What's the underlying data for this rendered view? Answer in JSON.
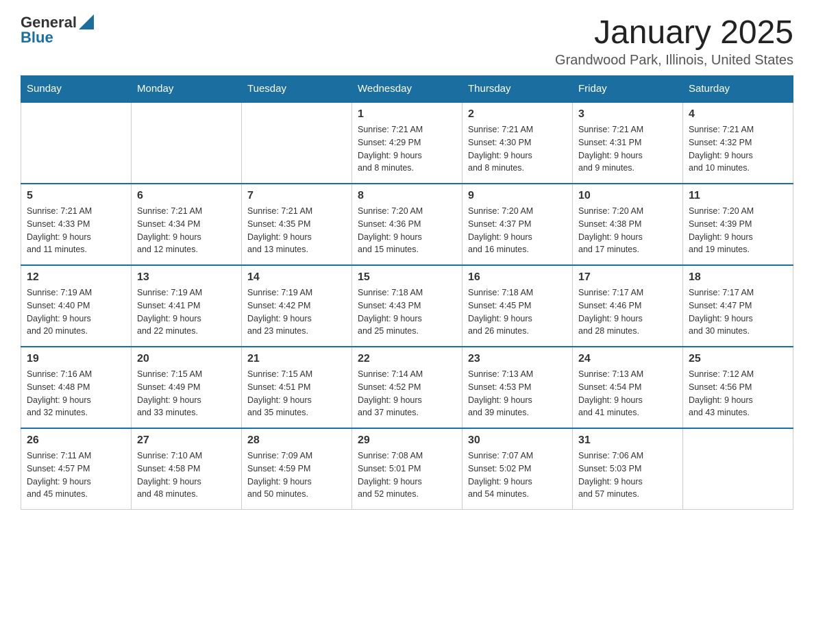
{
  "header": {
    "logo_general": "General",
    "logo_blue": "Blue",
    "month_title": "January 2025",
    "location": "Grandwood Park, Illinois, United States"
  },
  "days_of_week": [
    "Sunday",
    "Monday",
    "Tuesday",
    "Wednesday",
    "Thursday",
    "Friday",
    "Saturday"
  ],
  "weeks": [
    [
      {
        "day": "",
        "info": ""
      },
      {
        "day": "",
        "info": ""
      },
      {
        "day": "",
        "info": ""
      },
      {
        "day": "1",
        "info": "Sunrise: 7:21 AM\nSunset: 4:29 PM\nDaylight: 9 hours\nand 8 minutes."
      },
      {
        "day": "2",
        "info": "Sunrise: 7:21 AM\nSunset: 4:30 PM\nDaylight: 9 hours\nand 8 minutes."
      },
      {
        "day": "3",
        "info": "Sunrise: 7:21 AM\nSunset: 4:31 PM\nDaylight: 9 hours\nand 9 minutes."
      },
      {
        "day": "4",
        "info": "Sunrise: 7:21 AM\nSunset: 4:32 PM\nDaylight: 9 hours\nand 10 minutes."
      }
    ],
    [
      {
        "day": "5",
        "info": "Sunrise: 7:21 AM\nSunset: 4:33 PM\nDaylight: 9 hours\nand 11 minutes."
      },
      {
        "day": "6",
        "info": "Sunrise: 7:21 AM\nSunset: 4:34 PM\nDaylight: 9 hours\nand 12 minutes."
      },
      {
        "day": "7",
        "info": "Sunrise: 7:21 AM\nSunset: 4:35 PM\nDaylight: 9 hours\nand 13 minutes."
      },
      {
        "day": "8",
        "info": "Sunrise: 7:20 AM\nSunset: 4:36 PM\nDaylight: 9 hours\nand 15 minutes."
      },
      {
        "day": "9",
        "info": "Sunrise: 7:20 AM\nSunset: 4:37 PM\nDaylight: 9 hours\nand 16 minutes."
      },
      {
        "day": "10",
        "info": "Sunrise: 7:20 AM\nSunset: 4:38 PM\nDaylight: 9 hours\nand 17 minutes."
      },
      {
        "day": "11",
        "info": "Sunrise: 7:20 AM\nSunset: 4:39 PM\nDaylight: 9 hours\nand 19 minutes."
      }
    ],
    [
      {
        "day": "12",
        "info": "Sunrise: 7:19 AM\nSunset: 4:40 PM\nDaylight: 9 hours\nand 20 minutes."
      },
      {
        "day": "13",
        "info": "Sunrise: 7:19 AM\nSunset: 4:41 PM\nDaylight: 9 hours\nand 22 minutes."
      },
      {
        "day": "14",
        "info": "Sunrise: 7:19 AM\nSunset: 4:42 PM\nDaylight: 9 hours\nand 23 minutes."
      },
      {
        "day": "15",
        "info": "Sunrise: 7:18 AM\nSunset: 4:43 PM\nDaylight: 9 hours\nand 25 minutes."
      },
      {
        "day": "16",
        "info": "Sunrise: 7:18 AM\nSunset: 4:45 PM\nDaylight: 9 hours\nand 26 minutes."
      },
      {
        "day": "17",
        "info": "Sunrise: 7:17 AM\nSunset: 4:46 PM\nDaylight: 9 hours\nand 28 minutes."
      },
      {
        "day": "18",
        "info": "Sunrise: 7:17 AM\nSunset: 4:47 PM\nDaylight: 9 hours\nand 30 minutes."
      }
    ],
    [
      {
        "day": "19",
        "info": "Sunrise: 7:16 AM\nSunset: 4:48 PM\nDaylight: 9 hours\nand 32 minutes."
      },
      {
        "day": "20",
        "info": "Sunrise: 7:15 AM\nSunset: 4:49 PM\nDaylight: 9 hours\nand 33 minutes."
      },
      {
        "day": "21",
        "info": "Sunrise: 7:15 AM\nSunset: 4:51 PM\nDaylight: 9 hours\nand 35 minutes."
      },
      {
        "day": "22",
        "info": "Sunrise: 7:14 AM\nSunset: 4:52 PM\nDaylight: 9 hours\nand 37 minutes."
      },
      {
        "day": "23",
        "info": "Sunrise: 7:13 AM\nSunset: 4:53 PM\nDaylight: 9 hours\nand 39 minutes."
      },
      {
        "day": "24",
        "info": "Sunrise: 7:13 AM\nSunset: 4:54 PM\nDaylight: 9 hours\nand 41 minutes."
      },
      {
        "day": "25",
        "info": "Sunrise: 7:12 AM\nSunset: 4:56 PM\nDaylight: 9 hours\nand 43 minutes."
      }
    ],
    [
      {
        "day": "26",
        "info": "Sunrise: 7:11 AM\nSunset: 4:57 PM\nDaylight: 9 hours\nand 45 minutes."
      },
      {
        "day": "27",
        "info": "Sunrise: 7:10 AM\nSunset: 4:58 PM\nDaylight: 9 hours\nand 48 minutes."
      },
      {
        "day": "28",
        "info": "Sunrise: 7:09 AM\nSunset: 4:59 PM\nDaylight: 9 hours\nand 50 minutes."
      },
      {
        "day": "29",
        "info": "Sunrise: 7:08 AM\nSunset: 5:01 PM\nDaylight: 9 hours\nand 52 minutes."
      },
      {
        "day": "30",
        "info": "Sunrise: 7:07 AM\nSunset: 5:02 PM\nDaylight: 9 hours\nand 54 minutes."
      },
      {
        "day": "31",
        "info": "Sunrise: 7:06 AM\nSunset: 5:03 PM\nDaylight: 9 hours\nand 57 minutes."
      },
      {
        "day": "",
        "info": ""
      }
    ]
  ]
}
